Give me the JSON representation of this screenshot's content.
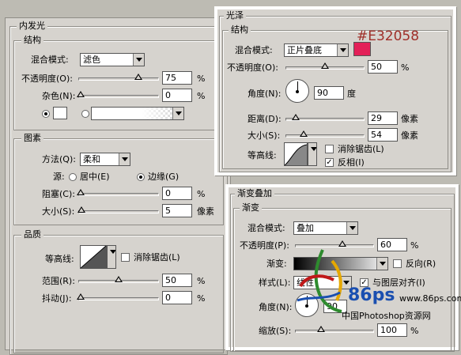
{
  "inner_glow": {
    "title": "内发光",
    "structure": {
      "title": "结构",
      "blend_label": "混合模式:",
      "blend_value": "滤色",
      "opacity_label": "不透明度(O):",
      "opacity_value": "75",
      "opacity_unit": "%",
      "noise_label": "杂色(N):",
      "noise_value": "0",
      "noise_unit": "%"
    },
    "elements": {
      "title": "图素",
      "method_label": "方法(Q):",
      "method_value": "柔和",
      "source_label": "源:",
      "source_center": "居中(E)",
      "source_edge": "边缘(G)",
      "choke_label": "阻塞(C):",
      "choke_value": "0",
      "choke_unit": "%",
      "size_label": "大小(S):",
      "size_value": "5",
      "size_unit": "像素"
    },
    "quality": {
      "title": "品质",
      "contour_label": "等高线:",
      "antialias_label": "消除锯齿(L)",
      "range_label": "范围(R):",
      "range_value": "50",
      "range_unit": "%",
      "jitter_label": "抖动(J):",
      "jitter_value": "0",
      "jitter_unit": "%"
    }
  },
  "satin": {
    "title": "光泽",
    "structure_title": "结构",
    "blend_label": "混合模式:",
    "blend_value": "正片叠底",
    "color_hex": "#E32058",
    "opacity_label": "不透明度(O):",
    "opacity_value": "50",
    "opacity_unit": "%",
    "angle_label": "角度(N):",
    "angle_value": "90",
    "angle_unit": "度",
    "distance_label": "距离(D):",
    "distance_value": "29",
    "distance_unit": "像素",
    "size_label": "大小(S):",
    "size_value": "54",
    "size_unit": "像素",
    "contour_label": "等高线:",
    "antialias_label": "消除锯齿(L)",
    "invert_label": "反相(I)"
  },
  "gradient_overlay": {
    "title": "渐变叠加",
    "section_title": "渐变",
    "blend_label": "混合模式:",
    "blend_value": "叠加",
    "opacity_label": "不透明度(P):",
    "opacity_value": "60",
    "opacity_unit": "%",
    "gradient_label": "渐变:",
    "reverse_label": "反向(R)",
    "style_label": "样式(L):",
    "style_value": "线性",
    "align_label": "与图层对齐(I)",
    "angle_label": "角度(N):",
    "angle_value": "90",
    "scale_label": "缩放(S):",
    "scale_value": "100",
    "scale_unit": "%"
  },
  "watermark": {
    "logo": "86ps",
    "url": "www.86ps.com",
    "text": "中国Photoshop资源网"
  },
  "colors": {
    "panel_bg": "#d6d3ce",
    "page_bg": "#bdbbb3",
    "satin_color": "#E32058",
    "hex_text": "#A0302A"
  }
}
